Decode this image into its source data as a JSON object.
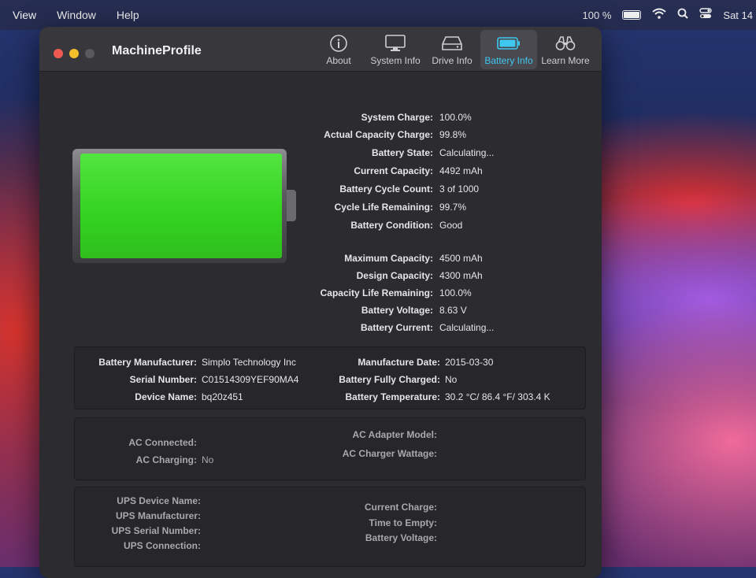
{
  "menubar": {
    "items": [
      "View",
      "Window",
      "Help"
    ],
    "battery_percent": "100 %",
    "clock": "Sat 14"
  },
  "window": {
    "title": "MachineProfile",
    "tabs": [
      {
        "label": "About",
        "icon": "info-icon"
      },
      {
        "label": "System Info",
        "icon": "monitor-icon"
      },
      {
        "label": "Drive Info",
        "icon": "drive-icon"
      },
      {
        "label": "Battery Info",
        "icon": "battery-icon"
      },
      {
        "label": "Learn More",
        "icon": "binoculars-icon"
      }
    ],
    "active_tab": "Battery Info"
  },
  "battery_level": 1.0,
  "battery_info": [
    {
      "label": "System Charge:",
      "value": "100.0%"
    },
    {
      "label": "Actual Capacity Charge:",
      "value": "99.8%"
    },
    {
      "label": "Battery State:",
      "value": "Calculating..."
    },
    {
      "label": "Current Capacity:",
      "value": "4492 mAh"
    },
    {
      "label": "Battery Cycle Count:",
      "value": "3 of 1000"
    },
    {
      "label": "Cycle Life Remaining:",
      "value": "99.7%"
    },
    {
      "label": "Battery Condition:",
      "value": "Good"
    }
  ],
  "capacity_info": [
    {
      "label": "Maximum Capacity:",
      "value": "4500 mAh"
    },
    {
      "label": "Design Capacity:",
      "value": "4300 mAh"
    },
    {
      "label": "Capacity Life Remaining:",
      "value": "100.0%"
    },
    {
      "label": "Battery Voltage:",
      "value": "8.63 V"
    },
    {
      "label": "Battery Current:",
      "value": "Calculating..."
    }
  ],
  "manufacturer_panel": {
    "left": [
      {
        "label": "Battery Manufacturer:",
        "value": "Simplo Technology Inc"
      },
      {
        "label": "Serial Number:",
        "value": "C01514309YEF90MA4"
      },
      {
        "label": "Device Name:",
        "value": "bq20z451"
      }
    ],
    "right": [
      {
        "label": "Manufacture Date:",
        "value": "2015-03-30"
      },
      {
        "label": "Battery Fully Charged:",
        "value": "No"
      },
      {
        "label": "Battery Temperature:",
        "value": "30.2 °C/ 86.4 °F/ 303.4 K"
      }
    ]
  },
  "ac_panel": {
    "left": [
      {
        "label": "AC Connected:",
        "value": ""
      },
      {
        "label": "AC Charging:",
        "value": "No"
      }
    ],
    "right": [
      {
        "label": "AC Adapter Model:",
        "value": ""
      },
      {
        "label": "AC Charger Wattage:",
        "value": ""
      }
    ]
  },
  "ups_panel": {
    "left": [
      {
        "label": "UPS Device Name:",
        "value": ""
      },
      {
        "label": "UPS Manufacturer:",
        "value": ""
      },
      {
        "label": "UPS Serial Number:",
        "value": ""
      },
      {
        "label": "UPS Connection:",
        "value": ""
      }
    ],
    "right": [
      {
        "label": "Current Charge:",
        "value": ""
      },
      {
        "label": "Time to Empty:",
        "value": ""
      },
      {
        "label": "Battery Voltage:",
        "value": ""
      }
    ]
  }
}
